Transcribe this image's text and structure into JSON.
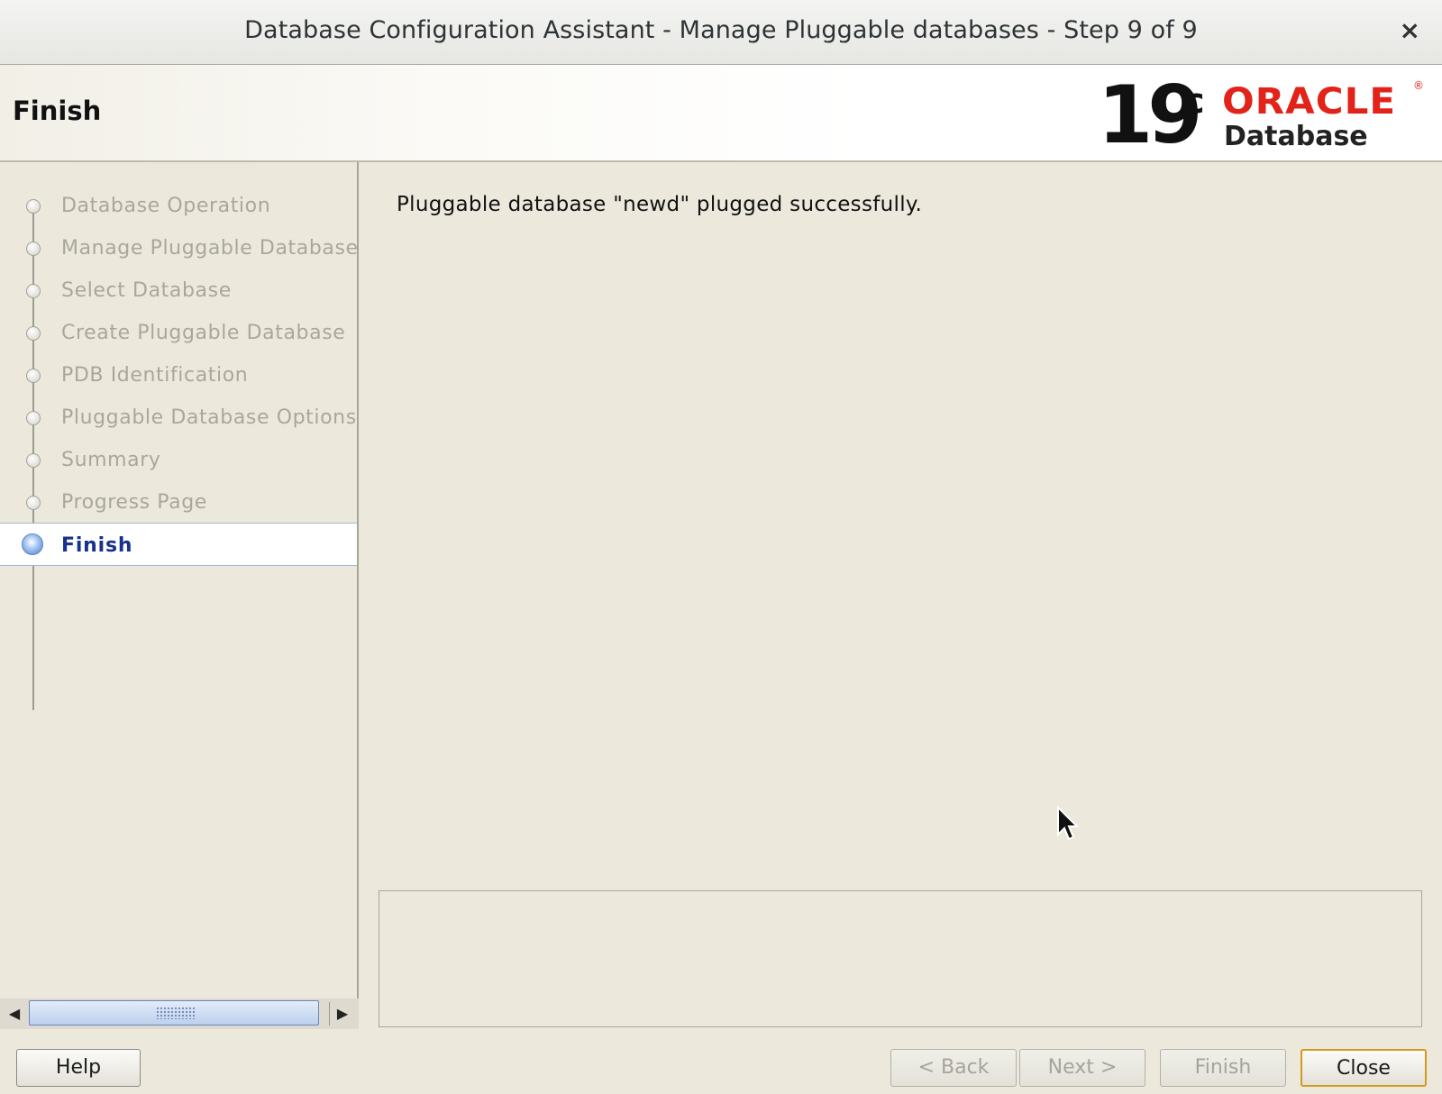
{
  "window": {
    "title": "Database Configuration Assistant - Manage Pluggable databases - Step 9 of 9",
    "close_glyph": "×"
  },
  "header": {
    "page_title": "Finish",
    "logo": {
      "version": "19",
      "version_sup": "c",
      "brand": "ORACLE",
      "reg_mark": "®",
      "product": "Database"
    }
  },
  "sidebar": {
    "steps": [
      {
        "label": "Database Operation",
        "state": "done"
      },
      {
        "label": "Manage Pluggable Databases",
        "state": "done"
      },
      {
        "label": "Select Database",
        "state": "done"
      },
      {
        "label": "Create Pluggable Database",
        "state": "done"
      },
      {
        "label": "PDB Identification",
        "state": "done"
      },
      {
        "label": "Pluggable Database Options",
        "state": "done"
      },
      {
        "label": "Summary",
        "state": "done"
      },
      {
        "label": "Progress Page",
        "state": "done"
      },
      {
        "label": "Finish",
        "state": "active"
      }
    ],
    "scroll_left_glyph": "◀",
    "scroll_right_glyph": "▶"
  },
  "content": {
    "message": "Pluggable database \"newd\" plugged successfully."
  },
  "footer": {
    "help": {
      "label": "Help",
      "enabled": true
    },
    "back": {
      "label": "< Back",
      "enabled": false
    },
    "next": {
      "label": "Next >",
      "enabled": false
    },
    "finish": {
      "label": "Finish",
      "enabled": false
    },
    "close": {
      "label": "Close",
      "enabled": true,
      "default": true
    }
  },
  "colors": {
    "background": "#ece9dc",
    "active_step_text": "#17318d",
    "disabled_text": "#a9a79c",
    "oracle_red": "#e2231a",
    "default_button_border": "#d39b1e"
  }
}
